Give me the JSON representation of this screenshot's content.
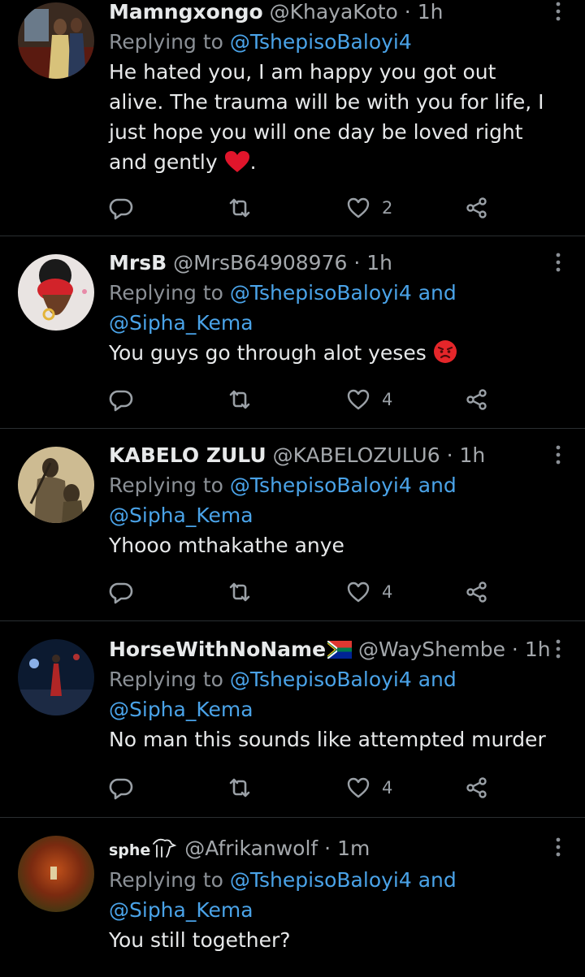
{
  "tweets": [
    {
      "name": "Mamngxongo",
      "handle": "@KhayaKoto",
      "time": "1h",
      "replying_prefix": "Replying to ",
      "mentions": [
        "@TshepisoBaloyi4"
      ],
      "and_word": "",
      "text": "He hated you, I am happy you got out alive. The trauma will be with you for life, I just hope you will one day be loved right and gently",
      "text_suffix": ".",
      "emoji": "heart-emoji",
      "likes": "2"
    },
    {
      "name": "MrsB",
      "handle": "@MrsB64908976",
      "time": "1h",
      "replying_prefix": "Replying to ",
      "mentions": [
        "@TshepisoBaloyi4",
        "@Sipha_Kema"
      ],
      "and_word": " and",
      "text": "You guys go through alot yeses",
      "emoji": "angry-face-emoji",
      "likes": "4"
    },
    {
      "name": "KABELO ZULU",
      "handle": "@KABELOZULU6",
      "time": "1h",
      "replying_prefix": "Replying to ",
      "mentions": [
        "@TshepisoBaloyi4",
        "@Sipha_Kema"
      ],
      "and_word": " and",
      "text": "Yhooo mthakathe anye",
      "likes": "4"
    },
    {
      "name": "HorseWithNoName",
      "handle": "@WayShembe",
      "time": "1h",
      "replying_prefix": "Replying to ",
      "mentions": [
        "@TshepisoBaloyi4",
        "@Sipha_Kema"
      ],
      "and_word": " and",
      "text": "No man this sounds like attempted murder",
      "emoji": "south-africa-flag-emoji",
      "likes": "4"
    },
    {
      "name": "sphe",
      "handle": "@Afrikanwolf",
      "time": "1m",
      "replying_prefix": "Replying to ",
      "mentions": [
        "@TshepisoBaloyi4",
        "@Sipha_Kema"
      ],
      "and_word": " and",
      "text": "You still together?",
      "emoji": "lion-emoji"
    }
  ],
  "separator": "·",
  "colors": {
    "background": "#000000",
    "mention": "#4aa3e8",
    "secondary": "#8b9096",
    "divider": "#2a2e31"
  }
}
